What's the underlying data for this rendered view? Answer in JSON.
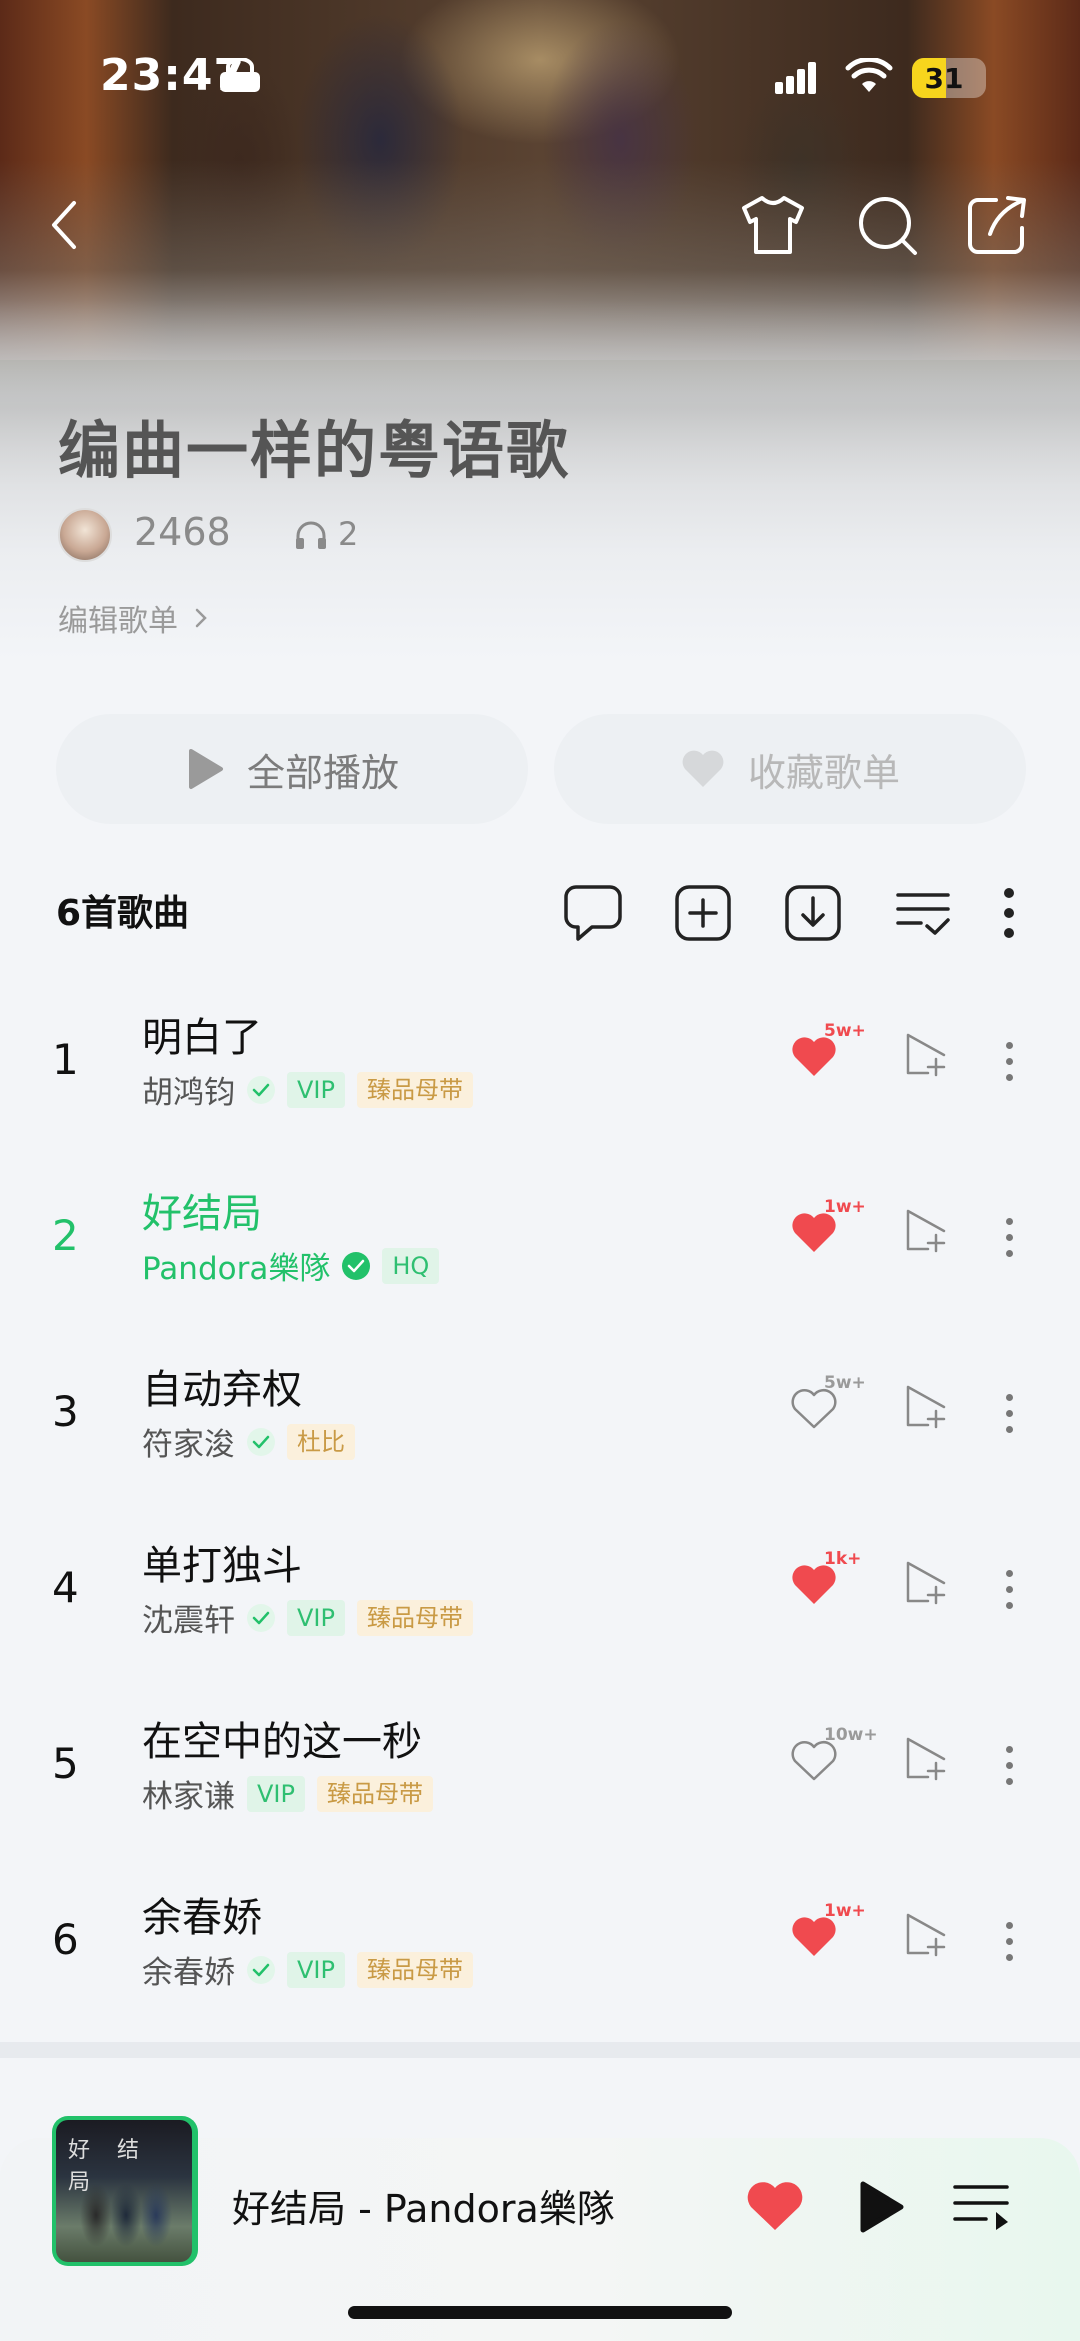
{
  "status_bar": {
    "time": "23:47",
    "battery": "31"
  },
  "playlist": {
    "title": "编曲一样的粤语歌",
    "owner": "2468",
    "listen_count": "2",
    "edit_label": "编辑歌单"
  },
  "actions": {
    "play_all": "全部播放",
    "favorite": "收藏歌单"
  },
  "list": {
    "count_label": "6首歌曲"
  },
  "songs": [
    {
      "index": "1",
      "title": "明白了",
      "artist": "胡鸿钧",
      "verified": true,
      "tags": [
        "VIP",
        "臻品母带"
      ],
      "liked": true,
      "likes": "5w+"
    },
    {
      "index": "2",
      "title": "好结局",
      "artist": "Pandora樂隊",
      "verified": true,
      "tags": [
        "HQ"
      ],
      "liked": true,
      "likes": "1w+",
      "playing": true
    },
    {
      "index": "3",
      "title": "自动弃权",
      "artist": "符家浚",
      "verified": true,
      "tags": [
        "杜比"
      ],
      "liked": false,
      "likes": "5w+"
    },
    {
      "index": "4",
      "title": "单打独斗",
      "artist": "沈震轩",
      "verified": true,
      "tags": [
        "VIP",
        "臻品母带"
      ],
      "liked": true,
      "likes": "1k+"
    },
    {
      "index": "5",
      "title": "在空中的这一秒",
      "artist": "林家谦",
      "verified": false,
      "tags": [
        "VIP",
        "臻品母带"
      ],
      "liked": false,
      "likes": "10w+"
    },
    {
      "index": "6",
      "title": "余春娇",
      "artist": "余春娇",
      "verified": true,
      "tags": [
        "VIP",
        "臻品母带"
      ],
      "liked": true,
      "likes": "1w+"
    }
  ],
  "now_playing": {
    "text": "好结局 - Pandora樂隊",
    "cover_text": "好 结 局"
  },
  "colors": {
    "accent": "#22c16a",
    "like": "#f04a4f"
  },
  "icons": [
    "back-icon",
    "tshirt-icon",
    "search-icon",
    "share-icon",
    "play-icon",
    "heart-icon",
    "comment-icon",
    "add-box-icon",
    "download-icon",
    "multi-select-icon",
    "more-icon",
    "add-to-queue-icon",
    "playlist-icon"
  ]
}
